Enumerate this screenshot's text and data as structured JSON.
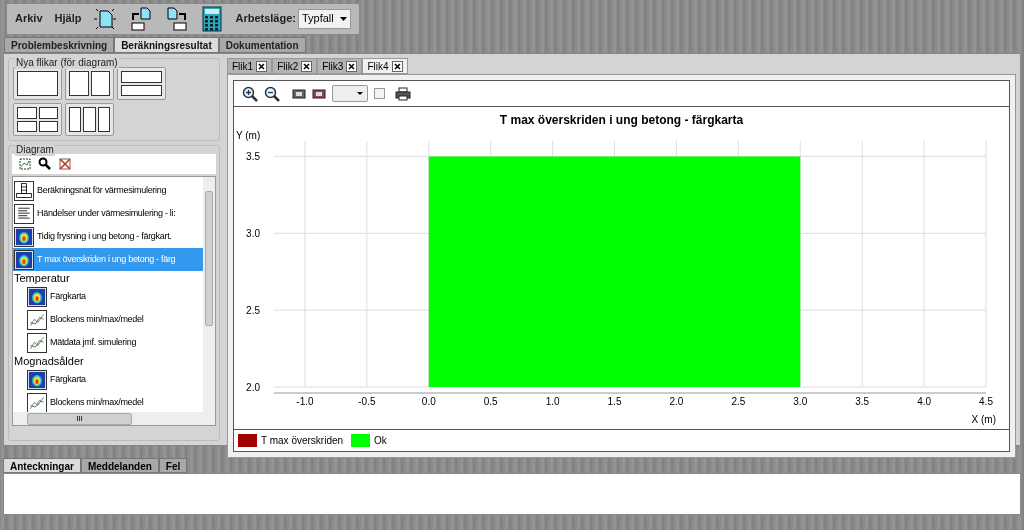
{
  "menu": {
    "items": [
      "Arkiv",
      "Hjälp"
    ],
    "mode_label": "Arbetsläge:",
    "mode_value": "Typfall"
  },
  "main_tabs": [
    {
      "label": "Problembeskrivning",
      "selected": false
    },
    {
      "label": "Beräkningsresultat",
      "selected": true
    },
    {
      "label": "Dokumentation",
      "selected": false
    }
  ],
  "new_tabs": {
    "title": "Nya flikar (för diagram)",
    "layouts": [
      {
        "kind": "single"
      },
      {
        "kind": "two-columns"
      },
      {
        "kind": "two-rows"
      },
      {
        "kind": "quad"
      },
      {
        "kind": "three-columns"
      }
    ]
  },
  "diagram": {
    "title": "Diagram",
    "tree": [
      {
        "label": "Beräkningsnät för värmesimulering",
        "kind": "mesh",
        "selected": false
      },
      {
        "label": "Händelser under värmesimulering - li:",
        "kind": "list",
        "selected": false
      },
      {
        "label": "Tidig frysning i ung betong - färgkart.",
        "kind": "colormap",
        "selected": false
      },
      {
        "label": "T max överskriden i ung betong - färg",
        "kind": "colormap",
        "selected": true
      },
      {
        "label": "Temperatur",
        "kind": "group",
        "selected": false,
        "children": [
          {
            "label": "Färgkarta",
            "kind": "colormap",
            "selected": false
          },
          {
            "label": "Blockens min/max/medel",
            "kind": "graph",
            "selected": false
          },
          {
            "label": "Mätdata jmf. simulering",
            "kind": "graph",
            "selected": false
          }
        ]
      },
      {
        "label": "Mognadsålder",
        "kind": "group",
        "selected": false,
        "children": [
          {
            "label": "Färgkarta",
            "kind": "colormap",
            "selected": false
          },
          {
            "label": "Blockens min/max/medel",
            "kind": "graph",
            "selected": false
          }
        ]
      }
    ],
    "hscroll_grip": "III"
  },
  "chart_tabs": [
    {
      "label": "Flik1",
      "selected": false
    },
    {
      "label": "Flik2",
      "selected": false
    },
    {
      "label": "Flik3",
      "selected": false
    },
    {
      "label": "Flik4",
      "selected": true
    }
  ],
  "chart": {
    "options_checked": false,
    "chart_data": {
      "type": "area",
      "grid": true,
      "title": "T max överskriden i ung betong - färgkarta",
      "xlabel": "X (m)",
      "ylabel": "Y (m)",
      "x": [
        0.0,
        3.0
      ],
      "series": [
        {
          "name": "T max överskriden",
          "color": "#a00000",
          "values": [
            null,
            null
          ]
        },
        {
          "name": "Ok",
          "color": "#00ff00",
          "values": [
            3.5,
            3.5
          ]
        }
      ],
      "xlim": [
        -1.25,
        4.5
      ],
      "ylim": [
        2.0,
        3.6
      ],
      "xticks": [
        {
          "value": -1,
          "label": "-1.0"
        },
        {
          "value": -0.5,
          "label": "-0.5"
        },
        {
          "value": 0,
          "label": "0.0"
        },
        {
          "value": 0.5,
          "label": "0.5"
        },
        {
          "value": 1,
          "label": "1.0"
        },
        {
          "value": 1.5,
          "label": "1.5"
        },
        {
          "value": 2,
          "label": "2.0"
        },
        {
          "value": 2.5,
          "label": "2.5"
        },
        {
          "value": 3,
          "label": "3.0"
        },
        {
          "value": 3.5,
          "label": "3.5"
        },
        {
          "value": 4,
          "label": "4.0"
        },
        {
          "value": 4.5,
          "label": "4.5"
        }
      ],
      "yticks": [
        {
          "value": 2,
          "label": "2.0"
        },
        {
          "value": 2.5,
          "label": "2.5"
        },
        {
          "value": 3,
          "label": "3.0"
        },
        {
          "value": 3.5,
          "label": "3.5"
        }
      ]
    }
  },
  "bottom_tabs": [
    {
      "label": "Anteckningar",
      "selected": true
    },
    {
      "label": "Meddelanden",
      "selected": false
    },
    {
      "label": "Fel",
      "selected": false
    }
  ]
}
